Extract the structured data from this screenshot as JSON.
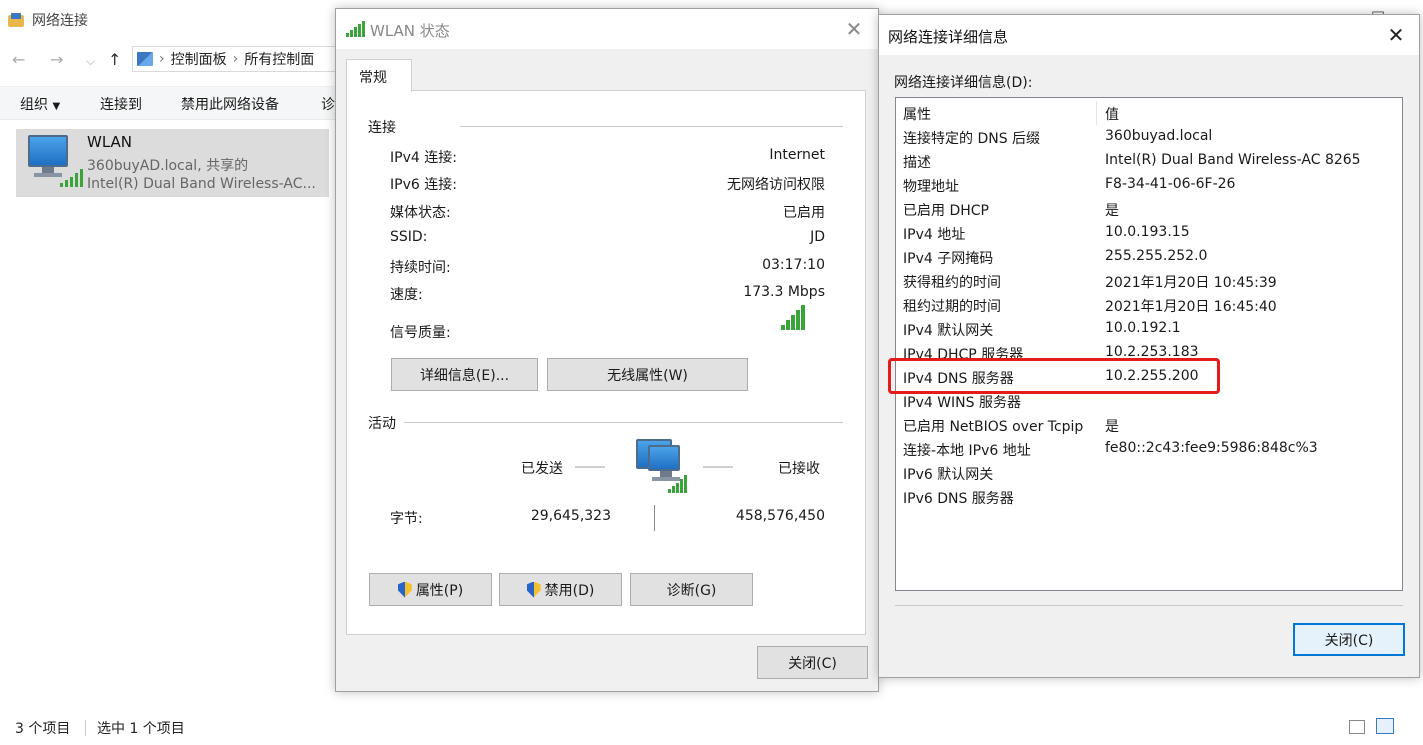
{
  "explorer": {
    "title": "网络连接",
    "breadcrumb": [
      "控制面板",
      "所有控制面"
    ],
    "toolbar": {
      "organize": "组织",
      "connect_to": "连接到",
      "disable_device": "禁用此网络设备",
      "diagnose": "诊"
    },
    "item": {
      "name": "WLAN",
      "sub1": "360buyAD.local, 共享的",
      "sub2": "Intel(R) Dual Band Wireless-AC..."
    },
    "status": {
      "count": "3 个项目",
      "selected": "选中 1 个项目"
    }
  },
  "wlan": {
    "title": "WLAN 状态",
    "tab": "常规",
    "connection": {
      "heading": "连接",
      "rows": [
        {
          "label": "IPv4 连接:",
          "value": "Internet"
        },
        {
          "label": "IPv6 连接:",
          "value": "无网络访问权限"
        },
        {
          "label": "媒体状态:",
          "value": "已启用"
        },
        {
          "label": "SSID:",
          "value": "JD"
        },
        {
          "label": "持续时间:",
          "value": "03:17:10"
        },
        {
          "label": "速度:",
          "value": "173.3 Mbps"
        },
        {
          "label": "信号质量:",
          "value": ""
        }
      ],
      "signal_level": 5,
      "signal_max": 5
    },
    "buttons": {
      "details": "详细信息(E)...",
      "wireless": "无线属性(W)",
      "properties": "属性(P)",
      "disable": "禁用(D)",
      "diagnose": "诊断(G)",
      "close": "关闭(C)"
    },
    "activity": {
      "heading": "活动",
      "sent_label": "已发送",
      "received_label": "已接收",
      "bytes_label": "字节:",
      "bytes_sent": "29,645,323",
      "bytes_received": "458,576,450"
    }
  },
  "details": {
    "title": "网络连接详细信息",
    "list_label": "网络连接详细信息(D):",
    "header": {
      "property": "属性",
      "value": "值"
    },
    "rows": [
      {
        "property": "连接特定的 DNS 后缀",
        "value": "360buyad.local"
      },
      {
        "property": "描述",
        "value": "Intel(R) Dual Band Wireless-AC 8265"
      },
      {
        "property": "物理地址",
        "value": "F8-34-41-06-6F-26"
      },
      {
        "property": "已启用 DHCP",
        "value": "是"
      },
      {
        "property": "IPv4 地址",
        "value": "10.0.193.15"
      },
      {
        "property": "IPv4 子网掩码",
        "value": "255.255.252.0"
      },
      {
        "property": "获得租约的时间",
        "value": "2021年1月20日 10:45:39"
      },
      {
        "property": "租约过期的时间",
        "value": "2021年1月20日 16:45:40"
      },
      {
        "property": "IPv4 默认网关",
        "value": "10.0.192.1"
      },
      {
        "property": "IPv4 DHCP 服务器",
        "value": "10.2.253.183"
      },
      {
        "property": "IPv4 DNS 服务器",
        "value": "10.2.255.200"
      },
      {
        "property": "IPv4 WINS 服务器",
        "value": ""
      },
      {
        "property": "已启用 NetBIOS over Tcpip",
        "value": "是"
      },
      {
        "property": "连接-本地 IPv6 地址",
        "value": "fe80::2c43:fee9:5986:848c%3"
      },
      {
        "property": "IPv6 默认网关",
        "value": ""
      },
      {
        "property": "IPv6 DNS 服务器",
        "value": ""
      }
    ],
    "close": "关闭(C)",
    "highlight_color": "#e31b1b"
  },
  "colors": {
    "accent": "#0078d7",
    "signal": "#3aa43a",
    "selection": "#dcdcdc"
  }
}
